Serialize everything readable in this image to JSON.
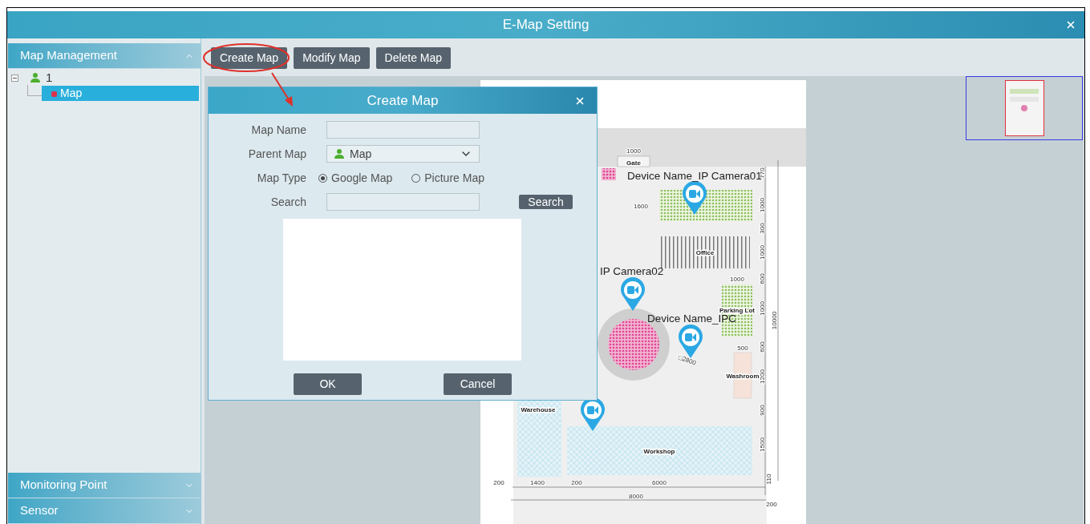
{
  "window": {
    "title": "E-Map Setting"
  },
  "sidebar": {
    "sections": [
      {
        "title": "Map Management",
        "expanded": true,
        "tree": [
          {
            "label": "1",
            "expanded": true,
            "children": [
              {
                "label": "Map",
                "selected": true
              }
            ]
          }
        ]
      },
      {
        "title": "Monitoring Point",
        "expanded": false
      },
      {
        "title": "Sensor",
        "expanded": false
      }
    ]
  },
  "toolbar": {
    "buttons": [
      {
        "label": "Create Map",
        "highlighted": true
      },
      {
        "label": "Modify Map",
        "highlighted": false
      },
      {
        "label": "Delete Map",
        "highlighted": false
      }
    ]
  },
  "map_view": {
    "camera_labels": [
      "Device Name_IP Camera01",
      "IP Camera02",
      "Device Name_IPC"
    ],
    "room_labels": [
      "Gate",
      "Office",
      "Parking Lot",
      "Washroom",
      "Warehouse",
      "Workshop"
    ],
    "dimension_labels": [
      "1000",
      "1600",
      "1000",
      "500",
      "□2800",
      "200",
      "1400",
      "200",
      "6000",
      "8000",
      "200",
      "110"
    ],
    "side_dimension_labels": [
      "770",
      "1000",
      "300",
      "1000",
      "600",
      "1000",
      "600",
      "1200",
      "900",
      "1500",
      "10000"
    ]
  },
  "dialog": {
    "title": "Create Map",
    "fields": [
      {
        "kind": "text",
        "label": "Map Name"
      },
      {
        "kind": "select",
        "label": "Parent Map",
        "value": "Map"
      },
      {
        "kind": "radio",
        "label": "Map Type",
        "options": [
          {
            "label": "Google Map",
            "selected": true
          },
          {
            "label": "Picture Map",
            "selected": false
          }
        ]
      },
      {
        "kind": "search",
        "label": "Search",
        "button": "Search"
      }
    ],
    "buttons": [
      "OK",
      "Cancel"
    ]
  }
}
